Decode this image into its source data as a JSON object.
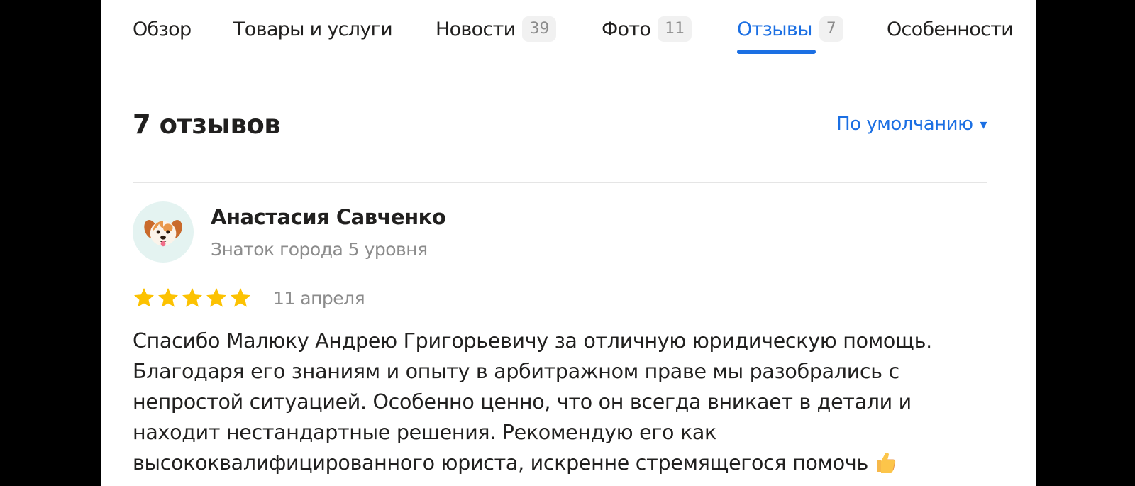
{
  "tabs": [
    {
      "label": "Обзор",
      "badge": null,
      "active": false
    },
    {
      "label": "Товары и услуги",
      "badge": null,
      "active": false
    },
    {
      "label": "Новости",
      "badge": "39",
      "active": false
    },
    {
      "label": "Фото",
      "badge": "11",
      "active": false
    },
    {
      "label": "Отзывы",
      "badge": "7",
      "active": true
    },
    {
      "label": "Особенности",
      "badge": null,
      "active": false
    }
  ],
  "reviews_header": {
    "title": "7 отзывов",
    "sort_label": "По умолчанию",
    "sort_caret": "▾"
  },
  "review": {
    "author_name": "Анастасия Савченко",
    "author_level": "Знаток города 5 уровня",
    "avatar_icon": "dog-face-icon",
    "rating": 5,
    "rating_max": 5,
    "date": "11 апреля",
    "text": "Спасибо Малюку Андрею Григорьевичу за отличную юридическую помощь. Благодаря его знаниям и опыту в арбитражном праве мы разобрались с непростой ситуацией. Особенно ценно, что он всегда вникает в детали и находит нестандартные решения. Рекомендую его как высококвалифицированного юриста, искренне стремящегося помочь"
  },
  "colors": {
    "accent": "#1b6fe3",
    "star": "#fcc202",
    "text": "#21201f",
    "muted": "#8c8c8c",
    "avatar_bg": "#e4f3f1"
  }
}
